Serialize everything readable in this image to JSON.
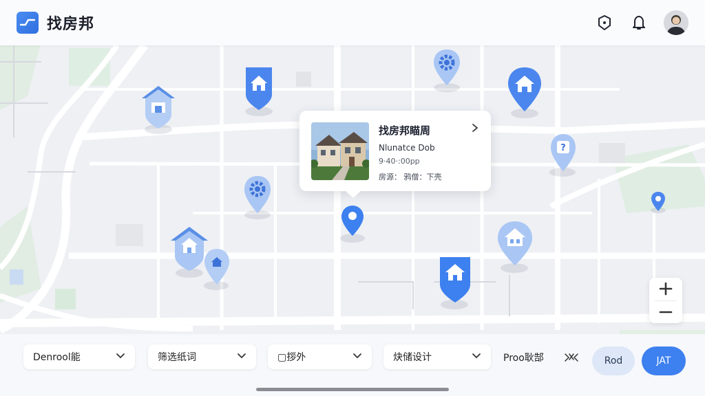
{
  "header": {
    "app_title": "找房邦",
    "icons": [
      "logo-icon",
      "location-alert-icon",
      "bell-icon",
      "user-avatar"
    ]
  },
  "card": {
    "title": "找房邦瞄周",
    "subtitle": "Nlunatce Dob",
    "price": "9·40·:00pp",
    "meta": "房源： 鸦僧：下壳"
  },
  "filters": [
    {
      "label": "Denrool能"
    },
    {
      "label": "筛选纸词"
    },
    {
      "label": "▢拶外"
    },
    {
      "label": "炔储设计"
    }
  ],
  "bottom": {
    "plain_label": "Proo耿郜",
    "secondary_button": "Rod",
    "primary_button": "JAT"
  },
  "colors": {
    "accent": "#3d80ef",
    "pin_solid": "#4b86ee",
    "pin_light": "#a9c6f4",
    "map_bg": "#eef0f4",
    "road": "#ffffff"
  }
}
